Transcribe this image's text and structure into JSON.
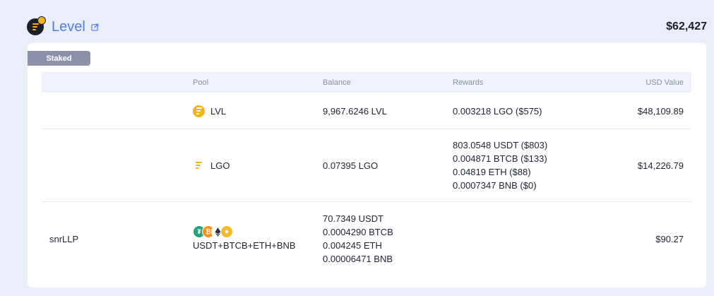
{
  "header": {
    "protocol_name": "Level",
    "total_value": "$62,427",
    "icons": {
      "logo": "level-logo-icon",
      "external": "external-link-icon"
    }
  },
  "section_tag": "Staked",
  "table": {
    "headers": {
      "pool": "Pool",
      "balance": "Balance",
      "rewards": "Rewards",
      "usd": "USD Value"
    },
    "rows": [
      {
        "label": "",
        "pool": "LVL",
        "pool_icon": "lvl-token-icon",
        "balance": [
          "9,967.6246 LVL"
        ],
        "rewards": [
          "0.003218 LGO ($575)"
        ],
        "usd": "$48,109.89"
      },
      {
        "label": "",
        "pool": "LGO",
        "pool_icon": "lgo-token-icon",
        "balance": [
          "0.07395 LGO"
        ],
        "rewards": [
          "803.0548 USDT ($803)",
          "0.004871 BTCB ($133)",
          "0.04819 ETH ($88)",
          "0.0007347 BNB ($0)"
        ],
        "usd": "$14,226.79"
      },
      {
        "label": "snrLLP",
        "pool": "USDT+BTCB+ETH+BNB",
        "pool_icons": [
          "usdt-token-icon",
          "btcb-token-icon",
          "eth-token-icon",
          "bnb-token-icon"
        ],
        "balance": [
          "70.7349 USDT",
          "0.0004290 BTCB",
          "0.004245 ETH",
          "0.00006471 BNB"
        ],
        "rewards": [],
        "usd": "$90.27"
      }
    ]
  },
  "colors": {
    "accent": "#4f7ee6",
    "level_gold": "#f5b415",
    "tag_bg": "#8b91aa",
    "page_bg": "#e9eef9"
  }
}
